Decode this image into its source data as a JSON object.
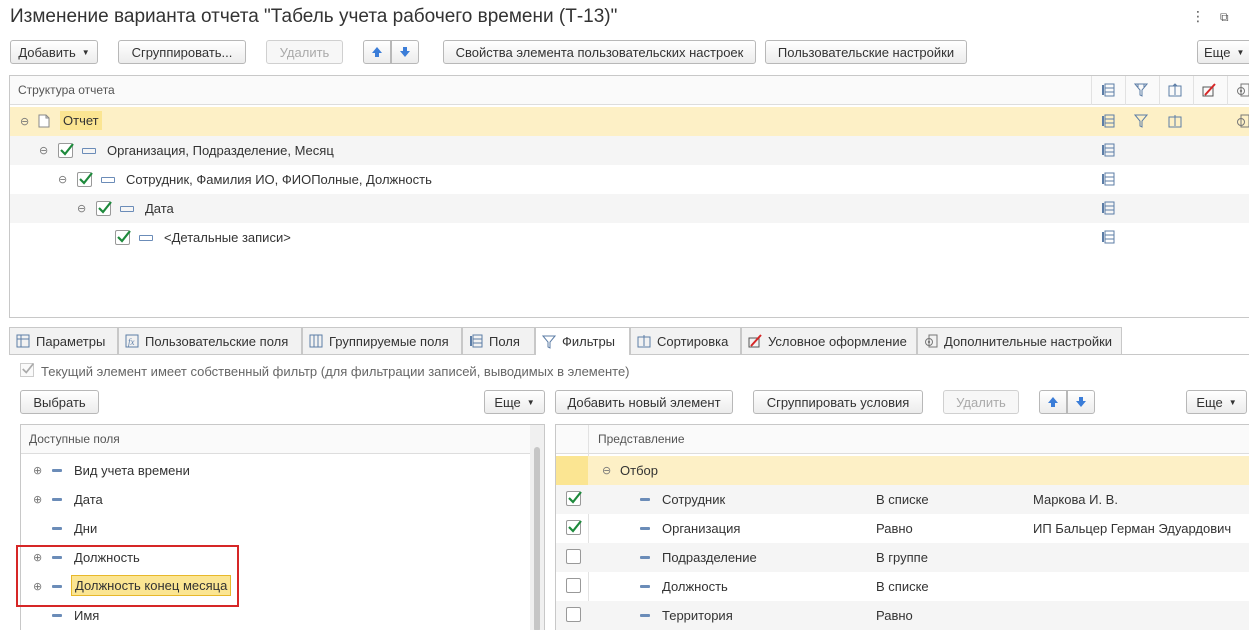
{
  "window": {
    "title": "Изменение варианта отчета \"Табель учета рабочего времени (Т-13)\"",
    "menu_icon": "⋮",
    "restore_icon": "⧉"
  },
  "toolbar": {
    "add": "Добавить",
    "group": "Сгруппировать...",
    "delete": "Удалить",
    "props": "Свойства элемента пользовательских настроек",
    "user_settings": "Пользовательские настройки",
    "more": "Еще"
  },
  "structure": {
    "header": "Структура отчета",
    "rows": [
      {
        "label": "Отчет",
        "level": 0
      },
      {
        "label": "Организация, Подразделение, Месяц",
        "level": 1,
        "checked": true
      },
      {
        "label": "Сотрудник, Фамилия ИО, ФИОПолные, Должность",
        "level": 2,
        "checked": true
      },
      {
        "label": "Дата",
        "level": 3,
        "checked": true
      },
      {
        "label": "<Детальные записи>",
        "level": 4,
        "checked": true
      }
    ]
  },
  "tabs": [
    {
      "label": "Параметры",
      "icon": "table-icon"
    },
    {
      "label": "Пользовательские поля",
      "icon": "fx-icon"
    },
    {
      "label": "Группируемые поля",
      "icon": "columns-icon"
    },
    {
      "label": "Поля",
      "icon": "fields-icon"
    },
    {
      "label": "Фильтры",
      "icon": "filter-icon"
    },
    {
      "label": "Сортировка",
      "icon": "sort-icon"
    },
    {
      "label": "Условное оформление",
      "icon": "format-icon"
    },
    {
      "label": "Дополнительные настройки",
      "icon": "gear-icon"
    }
  ],
  "own_filter": {
    "label": "Текущий элемент имеет собственный фильтр (для фильтрации записей, выводимых в элементе)",
    "checked": true
  },
  "left": {
    "select": "Выбрать",
    "more": "Еще",
    "header": "Доступные поля",
    "fields": [
      {
        "label": "Вид учета времени",
        "expandable": true
      },
      {
        "label": "Дата",
        "expandable": true
      },
      {
        "label": "Дни",
        "expandable": false
      },
      {
        "label": "Должность",
        "expandable": true
      },
      {
        "label": "Должность конец месяца",
        "expandable": true,
        "selected": true
      },
      {
        "label": "Имя",
        "expandable": false
      }
    ]
  },
  "right": {
    "add_new": "Добавить новый элемент",
    "group_cond": "Сгруппировать условия",
    "delete": "Удалить",
    "more": "Еще",
    "header": "Представление",
    "root": "Отбор",
    "rows": [
      {
        "field": "Сотрудник",
        "cond": "В списке",
        "value": "Маркова И. В.",
        "checked": true
      },
      {
        "field": "Организация",
        "cond": "Равно",
        "value": "ИП Бальцер Герман Эдуардович",
        "checked": true
      },
      {
        "field": "Подразделение",
        "cond": "В группе",
        "value": "",
        "checked": false
      },
      {
        "field": "Должность",
        "cond": "В списке",
        "value": "",
        "checked": false
      },
      {
        "field": "Территория",
        "cond": "Равно",
        "value": "",
        "checked": false
      }
    ]
  },
  "colors": {
    "accent": "#fdf0c6",
    "highlight_border": "#d62626",
    "check": "#1e8a3c"
  }
}
